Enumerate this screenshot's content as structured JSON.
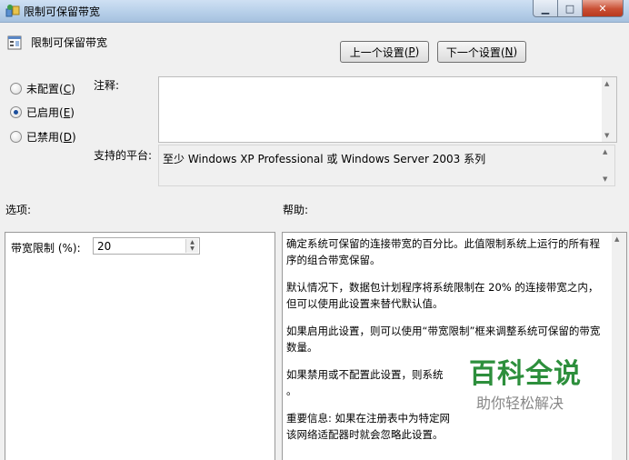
{
  "window": {
    "title": "限制可保留带宽"
  },
  "header": {
    "policy_title": "限制可保留带宽",
    "prev_label": "上一个设置(",
    "prev_mnemonic": "P",
    "next_label": "下一个设置(",
    "next_mnemonic": "N",
    "close_paren": ")"
  },
  "state": {
    "options": [
      {
        "label": "未配置(",
        "mnemonic": "C",
        "checked": false
      },
      {
        "label": "已启用(",
        "mnemonic": "E",
        "checked": true
      },
      {
        "label": "已禁用(",
        "mnemonic": "D",
        "checked": false
      }
    ],
    "close_paren": ")"
  },
  "comment": {
    "label": "注释:",
    "value": ""
  },
  "platform": {
    "label": "支持的平台:",
    "value": "至少 Windows XP Professional 或 Windows Server 2003 系列"
  },
  "options_section": {
    "label": "选项:",
    "bandwidth_label": "带宽限制 (%):",
    "bandwidth_value": "20"
  },
  "help_section": {
    "label": "帮助:",
    "paragraphs": [
      "确定系统可保留的连接带宽的百分比。此值限制系统上运行的所有程序的组合带宽保留。",
      "默认情况下，数据包计划程序将系统限制在 20% 的连接带宽之内，但可以使用此设置来替代默认值。",
      "如果启用此设置，则可以使用“带宽限制”框来调整系统可保留的带宽数量。",
      "如果禁用或不配置此设置，则系统",
      "重要信息: 如果在注册表中为特定网",
      "该网络适配器时就会忽略此设置。"
    ],
    "period_line": "。"
  },
  "watermark": {
    "title": "百科全说",
    "subtitle": "助你轻松解决"
  },
  "icons": {
    "title_icon": "network-policy-icon",
    "policy_icon": "policy-setting-icon"
  },
  "colors": {
    "accent": "#1c4f9c",
    "watermark_green": "#2d8f3c"
  }
}
